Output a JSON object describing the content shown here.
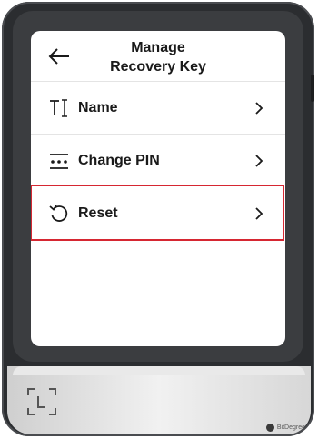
{
  "header": {
    "title_line1": "Manage",
    "title_line2": "Recovery Key"
  },
  "menu": {
    "items": [
      {
        "label": "Name",
        "icon": "text-cursor-icon"
      },
      {
        "label": "Change PIN",
        "icon": "pin-dots-icon"
      },
      {
        "label": "Reset",
        "icon": "reset-icon"
      }
    ]
  },
  "colors": {
    "highlight": "#d62732",
    "device": "#2b2d30",
    "screen": "#ffffff"
  },
  "watermark": "BitDegree"
}
